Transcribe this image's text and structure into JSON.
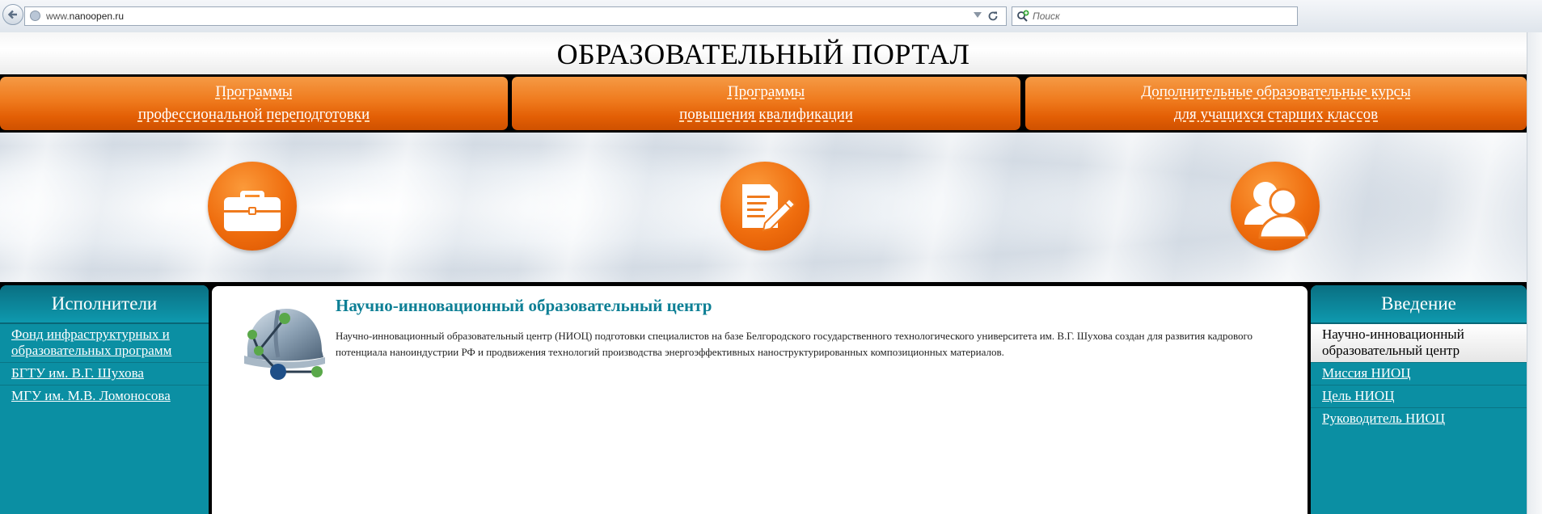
{
  "browser": {
    "url_prefix": "www.",
    "url_domain": "nanoopen.ru",
    "search_placeholder": "Поиск"
  },
  "header": {
    "title": "ОБРАЗОВАТЕЛЬНЫЙ ПОРТАЛ"
  },
  "nav": [
    {
      "line1": "Программы",
      "line2": "профессиональной переподготовки",
      "icon": "briefcase-icon"
    },
    {
      "line1": "Программы",
      "line2": "повышения квалификации",
      "icon": "document-pen-icon"
    },
    {
      "line1": "Дополнительные образовательные курсы",
      "line2": "для учащихся старших классов",
      "icon": "users-icon"
    }
  ],
  "left_panel": {
    "title": "Исполнители",
    "items": [
      "Фонд инфраструктурных и образовательных программ",
      "БГТУ им. В.Г. Шухова",
      "МГУ им. М.В. Ломоносова"
    ]
  },
  "main": {
    "title": "Научно-инновационный образовательный центр",
    "text": "Научно-инновационный образовательный центр (НИОЦ) подготовки специалистов на базе Белгородского государственного технологического университета им. В.Г. Шухова создан для развития кадрового потенциала наноиндустрии РФ и продвижения технологий производства энергоэффективных наноструктурированных композиционных материалов."
  },
  "right_panel": {
    "title": "Введение",
    "active": "Научно-инновационный образовательный центр",
    "items": [
      "Миссия НИОЦ",
      "Цель НИОЦ",
      "Руководитель НИОЦ"
    ]
  },
  "colors": {
    "accent_orange": "#ef7a1d",
    "teal": "#0b8fa3",
    "title_teal": "#0d7f95"
  }
}
